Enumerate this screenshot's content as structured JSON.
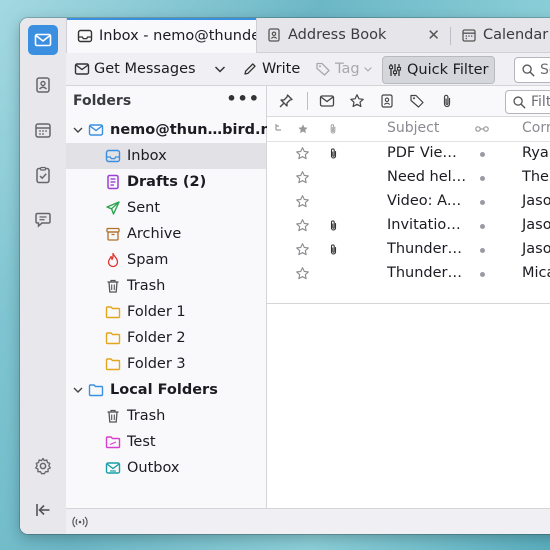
{
  "tabs": [
    {
      "label": "Inbox - nemo@thunderbird.net",
      "icon": "inbox-icon",
      "selected": true
    },
    {
      "label": "Address Book",
      "icon": "address-book-icon",
      "closable": true
    },
    {
      "label": "Calendar",
      "icon": "calendar-icon"
    }
  ],
  "toolbar": {
    "get_messages": "Get Messages",
    "write": "Write",
    "tag": "Tag",
    "quick_filter": "Quick Filter",
    "search_placeholder": "Search"
  },
  "folder_pane": {
    "header": "Folders",
    "more": "•••",
    "accounts": [
      {
        "name": "nemo@thun…bird.net",
        "folders": [
          {
            "label": "Inbox",
            "icon": "inbox-icon",
            "selected": true
          },
          {
            "label": "Drafts (2)",
            "icon": "drafts-icon",
            "bold": true
          },
          {
            "label": "Sent",
            "icon": "sent-icon"
          },
          {
            "label": "Archive",
            "icon": "archive-icon"
          },
          {
            "label": "Spam",
            "icon": "spam-icon"
          },
          {
            "label": "Trash",
            "icon": "trash-icon"
          },
          {
            "label": "Folder 1",
            "icon": "folder-icon"
          },
          {
            "label": "Folder 2",
            "icon": "folder-icon"
          },
          {
            "label": "Folder 3",
            "icon": "folder-icon"
          }
        ]
      },
      {
        "name": "Local Folders",
        "folders": [
          {
            "label": "Trash",
            "icon": "trash-icon"
          },
          {
            "label": "Test",
            "icon": "folder-icon"
          },
          {
            "label": "Outbox",
            "icon": "outbox-icon"
          }
        ]
      }
    ]
  },
  "quick_filter": {
    "search_placeholder": "Filter t"
  },
  "thread_columns": {
    "subject": "Subject",
    "correspondents": "Corr"
  },
  "messages": [
    {
      "subject": "PDF Viewer",
      "correspondent": "Ryan",
      "attachment": true
    },
    {
      "subject": "Need help…",
      "correspondent": "The",
      "attachment": false
    },
    {
      "subject": "Video: Ad…",
      "correspondent": "Jaso",
      "attachment": false
    },
    {
      "subject": "Invitation…",
      "correspondent": "Jaso",
      "attachment": true
    },
    {
      "subject": "Thunderb…",
      "correspondent": "Jaso",
      "attachment": true
    },
    {
      "subject": "Thunderb…",
      "correspondent": "Mica",
      "attachment": false
    }
  ],
  "colors": {
    "accent": "#3b8fe0",
    "drafts": "#9b3fd6",
    "sent": "#2ea44f",
    "archive": "#b0702a",
    "spam": "#e0342f",
    "folder": "#e3a51c",
    "test_folder": "#d63fd0",
    "outbox": "#18a0a8"
  }
}
